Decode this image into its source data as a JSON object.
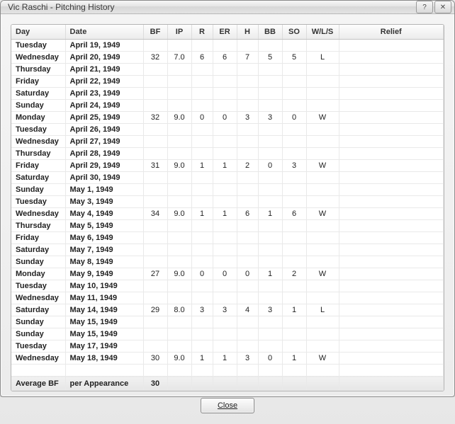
{
  "window": {
    "title": "Vic Raschi -  Pitching History",
    "help_tip": "?",
    "close_tip": "✕"
  },
  "columns": {
    "day": "Day",
    "date": "Date",
    "bf": "BF",
    "ip": "IP",
    "r": "R",
    "er": "ER",
    "h": "H",
    "bb": "BB",
    "so": "SO",
    "wls": "W/L/S",
    "relief": "Relief"
  },
  "rows": [
    {
      "day": "Tuesday",
      "date": "April 19, 1949"
    },
    {
      "day": "Wednesday",
      "date": "April 20, 1949",
      "bf": "32",
      "ip": "7.0",
      "r": "6",
      "er": "6",
      "h": "7",
      "bb": "5",
      "so": "5",
      "wls": "L"
    },
    {
      "day": "Thursday",
      "date": "April 21, 1949"
    },
    {
      "day": "Friday",
      "date": "April 22, 1949"
    },
    {
      "day": "Saturday",
      "date": "April 23, 1949"
    },
    {
      "day": "Sunday",
      "date": "April 24, 1949"
    },
    {
      "day": "Monday",
      "date": "April 25, 1949",
      "bf": "32",
      "ip": "9.0",
      "r": "0",
      "er": "0",
      "h": "3",
      "bb": "3",
      "so": "0",
      "wls": "W"
    },
    {
      "day": "Tuesday",
      "date": "April 26, 1949"
    },
    {
      "day": "Wednesday",
      "date": "April 27, 1949"
    },
    {
      "day": "Thursday",
      "date": "April 28, 1949"
    },
    {
      "day": "Friday",
      "date": "April 29, 1949",
      "bf": "31",
      "ip": "9.0",
      "r": "1",
      "er": "1",
      "h": "2",
      "bb": "0",
      "so": "3",
      "wls": "W"
    },
    {
      "day": "Saturday",
      "date": "April 30, 1949"
    },
    {
      "day": "Sunday",
      "date": "May 1, 1949"
    },
    {
      "day": "Tuesday",
      "date": "May 3, 1949"
    },
    {
      "day": "Wednesday",
      "date": "May 4, 1949",
      "bf": "34",
      "ip": "9.0",
      "r": "1",
      "er": "1",
      "h": "6",
      "bb": "1",
      "so": "6",
      "wls": "W"
    },
    {
      "day": "Thursday",
      "date": "May 5, 1949"
    },
    {
      "day": "Friday",
      "date": "May 6, 1949"
    },
    {
      "day": "Saturday",
      "date": "May 7, 1949"
    },
    {
      "day": "Sunday",
      "date": "May 8, 1949"
    },
    {
      "day": "Monday",
      "date": "May 9, 1949",
      "bf": "27",
      "ip": "9.0",
      "r": "0",
      "er": "0",
      "h": "0",
      "bb": "1",
      "so": "2",
      "wls": "W"
    },
    {
      "day": "Tuesday",
      "date": "May 10, 1949"
    },
    {
      "day": "Wednesday",
      "date": "May 11, 1949"
    },
    {
      "day": "Saturday",
      "date": "May 14, 1949",
      "bf": "29",
      "ip": "8.0",
      "r": "3",
      "er": "3",
      "h": "4",
      "bb": "3",
      "so": "1",
      "wls": "L"
    },
    {
      "day": "Sunday",
      "date": "May 15, 1949"
    },
    {
      "day": "Sunday",
      "date": "May 15, 1949"
    },
    {
      "day": "Tuesday",
      "date": "May 17, 1949"
    },
    {
      "day": "Wednesday",
      "date": "May 18, 1949",
      "bf": "30",
      "ip": "9.0",
      "r": "1",
      "er": "1",
      "h": "3",
      "bb": "0",
      "so": "1",
      "wls": "W"
    }
  ],
  "summary": {
    "label_day": "Average BF",
    "label_date": "per Appearance",
    "bf": "30"
  },
  "buttons": {
    "close": "Close"
  }
}
